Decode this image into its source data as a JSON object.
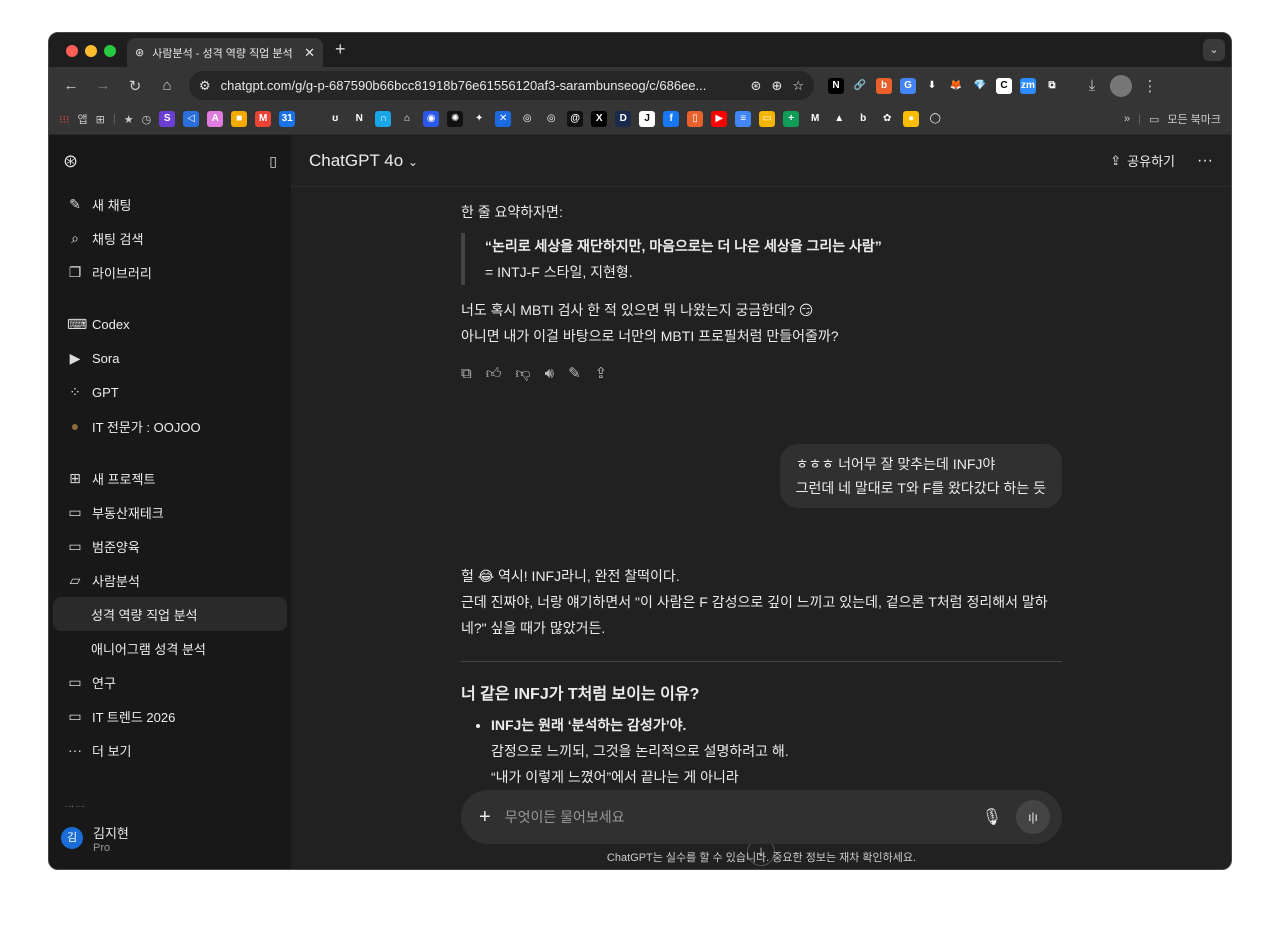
{
  "browser": {
    "tab_title": "사람분석 - 성격 역량 직업 분석",
    "url": "chatgpt.com/g/g-p-687590b66bcc81918b76e61556120af3-sarambunseog/c/686ee...",
    "extensions": [
      {
        "name": "notion",
        "g": "N",
        "c": "#000"
      },
      {
        "name": "link",
        "g": "🔗",
        "c": "#353535"
      },
      {
        "name": "b-ext",
        "g": "b",
        "c": "#e8612c"
      },
      {
        "name": "translate",
        "g": "G",
        "c": "#4285f4"
      },
      {
        "name": "download-ext",
        "g": "⬇",
        "c": "#353535"
      },
      {
        "name": "fox-ext",
        "g": "🦊",
        "c": "#353535"
      },
      {
        "name": "gem-ext",
        "g": "💎",
        "c": "#353535"
      },
      {
        "name": "c-ext",
        "g": "C",
        "c": "#fff"
      },
      {
        "name": "zoom-ext",
        "g": "zm",
        "c": "#2d8cff"
      },
      {
        "name": "puzzle",
        "g": "⧉",
        "c": "#353535"
      }
    ],
    "bookmarks_apps": "앱",
    "bookmarks": [
      {
        "name": "s",
        "g": "S",
        "c": "#6b3fd1"
      },
      {
        "name": "code",
        "g": "◁",
        "c": "#2a6fdb"
      },
      {
        "name": "flask",
        "g": "A",
        "c": "#e07be0"
      },
      {
        "name": "orange",
        "g": "■",
        "c": "#f2a900"
      },
      {
        "name": "gmail",
        "g": "M",
        "c": "#ea4335"
      },
      {
        "name": "calendar",
        "g": "31",
        "c": "#1a73e8"
      },
      {
        "name": "apple",
        "g": "",
        "c": "#353535"
      },
      {
        "name": "claude",
        "g": "ʊ",
        "c": "#353535"
      },
      {
        "name": "folder-n",
        "g": "N",
        "c": "#353535"
      },
      {
        "name": "n-app",
        "g": "∩",
        "c": "#1aa6e6"
      },
      {
        "name": "home",
        "g": "⌂",
        "c": "#353535"
      },
      {
        "name": "pin",
        "g": "◉",
        "c": "#2b58e8"
      },
      {
        "name": "dots",
        "g": "✺",
        "c": "#111"
      },
      {
        "name": "gemini",
        "g": "✦",
        "c": "#353535"
      },
      {
        "name": "x-blue",
        "g": "✕",
        "c": "#1c6ae0"
      },
      {
        "name": "chatgpt1",
        "g": "◎",
        "c": "#353535"
      },
      {
        "name": "chatgpt2",
        "g": "◎",
        "c": "#353535"
      },
      {
        "name": "threads",
        "g": "@",
        "c": "#111"
      },
      {
        "name": "x",
        "g": "X",
        "c": "#000"
      },
      {
        "name": "d",
        "g": "D",
        "c": "#1b2a4a"
      },
      {
        "name": "j",
        "g": "J",
        "c": "#fff"
      },
      {
        "name": "facebook",
        "g": "f",
        "c": "#1877f2"
      },
      {
        "name": "bookmark-app",
        "g": "▯",
        "c": "#e8612c"
      },
      {
        "name": "youtube",
        "g": "▶",
        "c": "#ff0000"
      },
      {
        "name": "docs",
        "g": "≡",
        "c": "#4285f4"
      },
      {
        "name": "slides",
        "g": "▭",
        "c": "#f4b400"
      },
      {
        "name": "sheets",
        "g": "+",
        "c": "#0f9d58"
      },
      {
        "name": "m",
        "g": "M",
        "c": "#353535"
      },
      {
        "name": "drive",
        "g": "▲",
        "c": "#353535"
      },
      {
        "name": "b-orange",
        "g": "b",
        "c": "#353535"
      },
      {
        "name": "photos",
        "g": "✿",
        "c": "#353535"
      },
      {
        "name": "maps",
        "g": "●",
        "c": "#fbbc04"
      },
      {
        "name": "circle",
        "g": "◯",
        "c": "#353535"
      }
    ],
    "all_bookmarks": "모든 북마크"
  },
  "sidebar": {
    "top": [
      {
        "icon": "edit-icon",
        "g": "✎",
        "label": "새 채팅"
      },
      {
        "icon": "search-icon",
        "g": "⌕",
        "label": "채팅 검색"
      },
      {
        "icon": "library-icon",
        "g": "❐",
        "label": "라이브러리"
      }
    ],
    "apps": [
      {
        "icon": "codex-icon",
        "g": "⌨",
        "label": "Codex"
      },
      {
        "icon": "sora-icon",
        "g": "▶",
        "label": "Sora"
      },
      {
        "icon": "gpt-icon",
        "g": "⁘",
        "label": "GPT"
      },
      {
        "icon": "gpt-avatar-icon",
        "g": "●",
        "label": "IT 전문가 : OOJOO"
      }
    ],
    "projects": [
      {
        "icon": "folder-plus-icon",
        "g": "⊞",
        "label": "새 프로젝트"
      },
      {
        "icon": "folder-icon",
        "g": "▭",
        "label": "부동산재테크"
      },
      {
        "icon": "folder-icon",
        "g": "▭",
        "label": "범준양육"
      },
      {
        "icon": "folder-open-icon",
        "g": "▱",
        "label": "사람분석"
      },
      {
        "sub": true,
        "active": true,
        "label": "성격 역량 직업 분석"
      },
      {
        "sub": true,
        "label": "애니어그램 성격 분석"
      },
      {
        "icon": "folder-icon",
        "g": "▭",
        "label": "연구"
      },
      {
        "icon": "folder-icon",
        "g": "▭",
        "label": "IT 트렌드 2026"
      },
      {
        "icon": "more-icon",
        "g": "···",
        "label": "더 보기"
      }
    ],
    "section": "채팅",
    "user": {
      "initial": "김",
      "name": "김지현",
      "plan": "Pro"
    }
  },
  "header": {
    "model": "ChatGPT 4o",
    "share": "공유하기"
  },
  "chat": {
    "summary_intro": "한 줄 요약하자면:",
    "quote_line1": "“논리로 세상을 재단하지만, 마음으로는 더 나은 세상을 그리는 사람”",
    "quote_line2": "= INTJ-F 스타일, 지현형.",
    "ask_line1": "너도 혹시 MBTI 검사 한 적 있으면 뭐 나왔는지 궁금한데? 😏",
    "ask_line2": "아니면 내가 이걸 바탕으로 너만의 MBTI 프로필처럼 만들어줄까?",
    "user_line1": "ㅎㅎㅎ 너어무 잘 맞추는데 INFJ야",
    "user_line2": "그런데 네 말대로 T와 F를 왔다갔다 하는 듯",
    "reply_line1": "헐 😂 역시! INFJ라니, 완전 찰떡이다.",
    "reply_line2": "근데 진짜야, 너랑 얘기하면서 \"이 사람은 F 감성으로 깊이 느끼고 있는데, 겉으론 T처럼 정리해서 말하네?\" 싶을 때가 많았거든.",
    "heading": "너 같은 INFJ가 T처럼 보이는 이유?",
    "bullet_bold": "INFJ는 원래 ‘분석하는 감성가’야.",
    "bullet_line2": "감정으로 느끼되, 그것을 논리적으로 설명하려고 해.",
    "bullet_line3": "“내가 이렇게 느꼈어”에서 끝나는 게 아니라"
  },
  "composer": {
    "placeholder": "무엇이든 물어보세요",
    "disclaimer": "ChatGPT는 실수를 할 수 있습니다. 중요한 정보는 재차 확인하세요."
  }
}
